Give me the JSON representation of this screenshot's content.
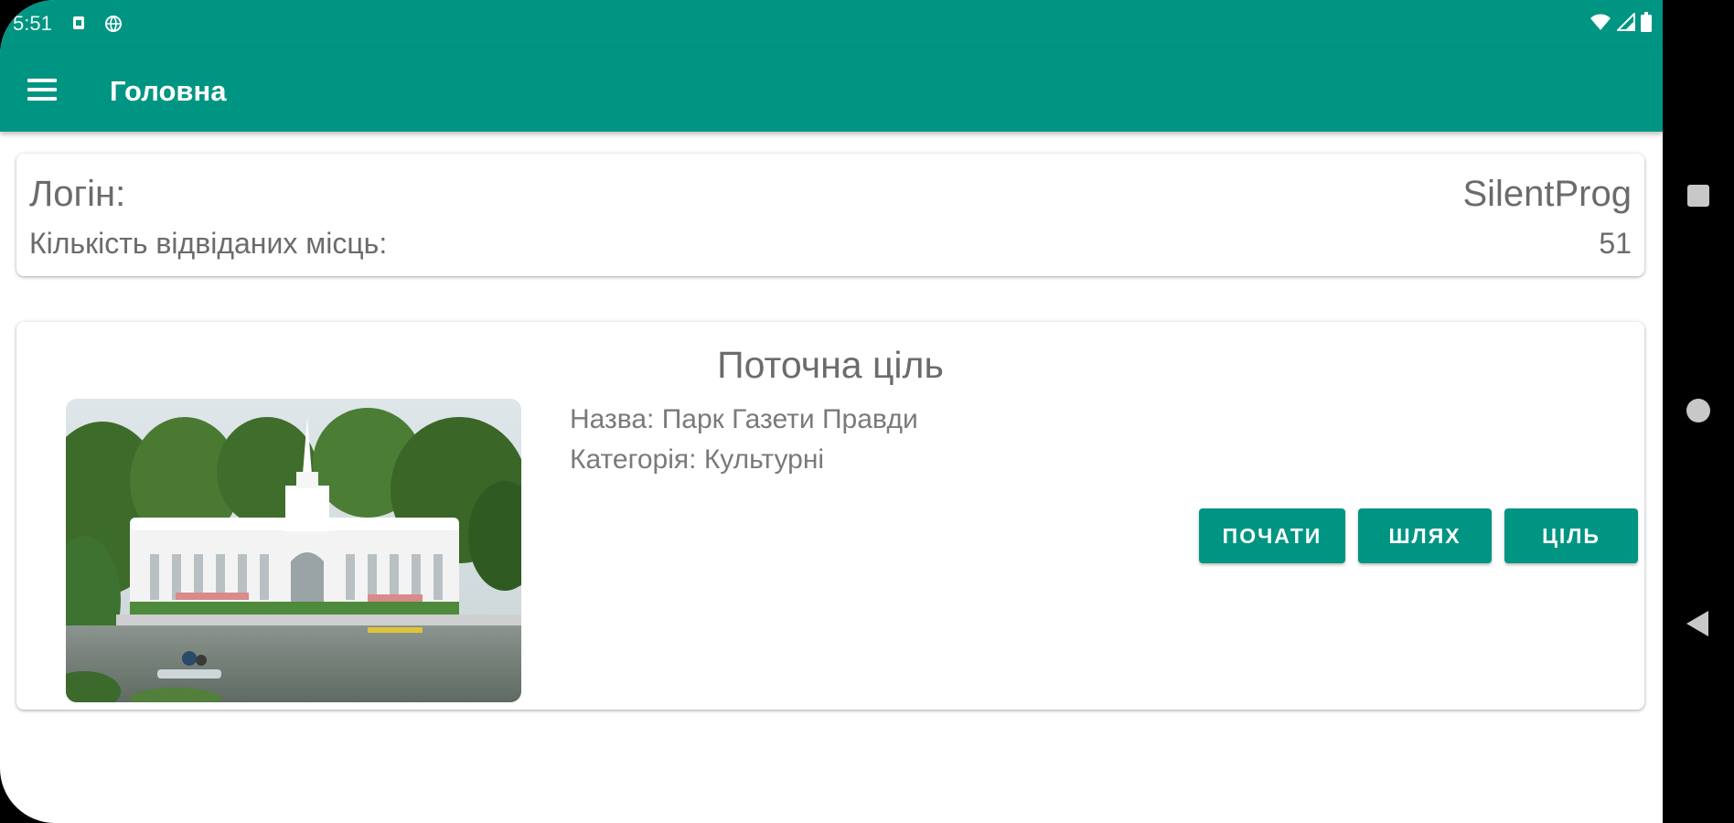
{
  "status_bar": {
    "time": "5:51",
    "notification_icons": [
      "sim-card-icon",
      "globe-icon"
    ],
    "right_icons": [
      "wifi-icon",
      "signal-icon",
      "battery-icon"
    ]
  },
  "app_bar": {
    "title": "Головна",
    "menu_icon": "hamburger-menu-icon",
    "color": "#009582"
  },
  "profile": {
    "login_label": "Логін:",
    "login_value": "SilentProg",
    "visited_label": "Кількість відвіданих місць:",
    "visited_value": "51"
  },
  "target": {
    "title": "Поточна ціль",
    "name": "Назва: Парк Газети Правди",
    "category": "Категорія: Культурні",
    "buttons": {
      "start": "ПОЧАТИ",
      "route": "ШЛЯХ",
      "goal": "ЦІЛЬ"
    }
  },
  "nav_bar": {
    "icons": [
      "recents-square-icon",
      "home-circle-icon",
      "back-triangle-icon"
    ]
  },
  "colors": {
    "primary": "#009582",
    "text_secondary": "#6b6b6b"
  }
}
